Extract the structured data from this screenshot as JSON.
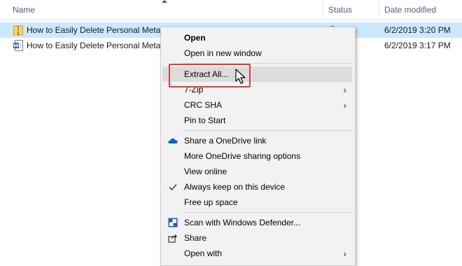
{
  "columns": {
    "name": "Name",
    "status": "Status",
    "date_modified": "Date modified"
  },
  "files": [
    {
      "name": "How to Easily Delete Personal Metad",
      "date": "6/2/2019 3:20 PM",
      "icon": "zip-folder-icon",
      "selected": true
    },
    {
      "name": "How to Easily Delete Personal Metad",
      "date": "6/2/2019 3:17 PM",
      "icon": "word-document-icon",
      "selected": false
    }
  ],
  "menu": {
    "open": "Open",
    "open_new_window": "Open in new window",
    "extract_all": "Extract All...",
    "seven_zip": "7-Zip",
    "crc_sha": "CRC SHA",
    "pin_to_start": "Pin to Start",
    "share_onedrive": "Share a OneDrive link",
    "more_onedrive": "More OneDrive sharing options",
    "view_online": "View online",
    "always_keep": "Always keep on this device",
    "free_up_space": "Free up space",
    "scan_defender": "Scan with Windows Defender...",
    "share": "Share",
    "open_with": "Open with"
  },
  "colors": {
    "selection": "#cce8ff",
    "highlight_box": "#e03b3b",
    "onedrive": "#0a64c8",
    "defender": "#1e5fb4"
  }
}
